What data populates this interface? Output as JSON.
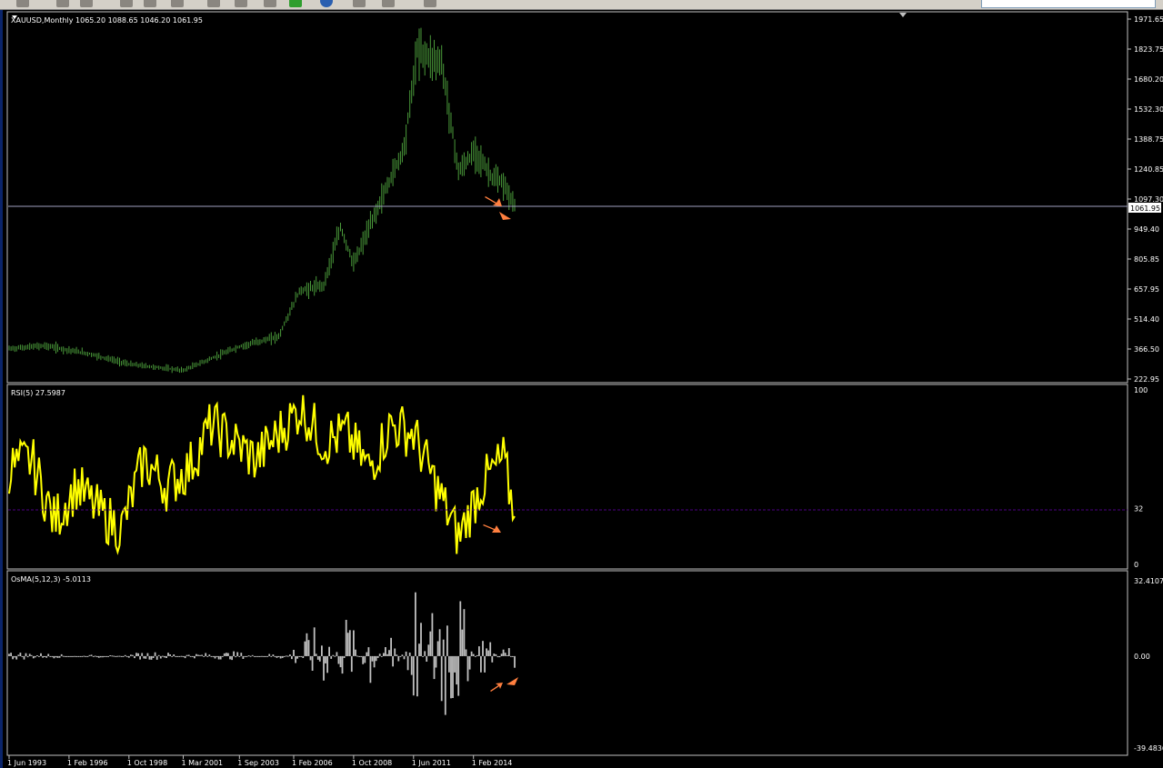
{
  "colors": {
    "background": "#000000",
    "price_bars": "#4a9a3a",
    "rsi_line": "#ffff00",
    "osma_bars": "#c0c0c0",
    "grid_frame": "#c0c0c0",
    "arrow": "#ff7f3f",
    "current_price_line": "#a0a0c0",
    "rsi_level_line": "#4b0082"
  },
  "toolbar": {
    "icons": [
      "new-chart-icon",
      "folder-icon",
      "save-icon",
      "zoom-in-icon",
      "zoom-out-icon",
      "pencil-icon",
      "pen-icon",
      "period-separator-icon",
      "grid-icon",
      "add-indicator-icon",
      "refresh-icon",
      "image-icon",
      "cursor-icon",
      "crosshair-icon",
      "line-icon",
      "text-icon",
      "arrow-icon",
      "timeframe-icon"
    ]
  },
  "main_pane": {
    "title": "XAUUSD,Monthly  1065.20 1088.65 1046.20 1061.95",
    "current_price_label": "1061.95",
    "price_axis": [
      "1971.65",
      "1823.75",
      "1680.20",
      "1532.30",
      "1388.75",
      "1240.85",
      "1097.30",
      "949.40",
      "805.85",
      "657.95",
      "514.40",
      "366.50",
      "222.95"
    ]
  },
  "rsi_pane": {
    "title": "RSI(5) 27.5987",
    "axis": [
      "100",
      "32",
      "0"
    ]
  },
  "osma_pane": {
    "title": "OsMA(5,12,3) -5.0113",
    "axis": [
      "32.4107",
      "0.00",
      "-39.4836"
    ]
  },
  "time_axis": [
    "1 Jun 1993",
    "1 Feb 1996",
    "1 Oct 1998",
    "1 Mar 2001",
    "1 Sep 2003",
    "1 Feb 2006",
    "1 Oct 2008",
    "1 Jun 2011",
    "1 Feb 2014"
  ],
  "chart_data": [
    {
      "type": "ohlc",
      "title": "XAUUSD,Monthly",
      "ylim": [
        222.95,
        1971.65
      ],
      "x_range": [
        "Jun 1993",
        "Dec 2015"
      ],
      "series": [
        {
          "name": "XAUUSD",
          "x": [
            "1993-06",
            "1995-01",
            "1997-01",
            "1998-10",
            "2001-03",
            "2003-09",
            "2005-06",
            "2006-05",
            "2007-06",
            "2008-03",
            "2008-10",
            "2010-01",
            "2011-01",
            "2011-08",
            "2012-09",
            "2013-06",
            "2014-03",
            "2014-12",
            "2015-06",
            "2015-12"
          ],
          "values": [
            370,
            385,
            345,
            295,
            265,
            380,
            430,
            650,
            680,
            960,
            780,
            1100,
            1350,
            1820,
            1760,
            1230,
            1330,
            1200,
            1170,
            1061.95
          ]
        }
      ]
    },
    {
      "type": "line",
      "title": "RSI(5) 27.5987",
      "ylim": [
        0,
        100
      ],
      "levels": [
        32
      ],
      "series": [
        {
          "name": "RSI(5)",
          "x": [
            "1993-06",
            "1994-06",
            "1995-06",
            "1996-06",
            "1997-06",
            "1998-06",
            "1999-06",
            "2000-06",
            "2001-06",
            "2002-06",
            "2003-06",
            "2004-06",
            "2005-06",
            "2006-06",
            "2007-06",
            "2008-06",
            "2009-06",
            "2010-06",
            "2011-06",
            "2012-06",
            "2013-06",
            "2014-06",
            "2015-06",
            "2015-12"
          ],
          "values": [
            55,
            60,
            25,
            45,
            30,
            20,
            60,
            45,
            55,
            80,
            70,
            60,
            75,
            90,
            70,
            75,
            55,
            80,
            75,
            45,
            15,
            45,
            60,
            27.6
          ]
        }
      ]
    },
    {
      "type": "bar",
      "title": "OsMA(5,12,3) -5.0113",
      "ylim": [
        -39.4836,
        32.4107
      ],
      "series": [
        {
          "name": "OsMA(5,12,3)",
          "x": [
            "1993",
            "1995",
            "1997",
            "1999",
            "2001",
            "2003",
            "2005",
            "2006",
            "2007",
            "2008",
            "2009",
            "2010",
            "2011",
            "2012",
            "2013",
            "2014",
            "2015"
          ],
          "values": [
            2,
            1,
            -1,
            2,
            1,
            2,
            -2,
            8,
            15,
            -20,
            18,
            -15,
            32,
            -40,
            -25,
            12,
            -5.0113
          ]
        }
      ]
    }
  ]
}
